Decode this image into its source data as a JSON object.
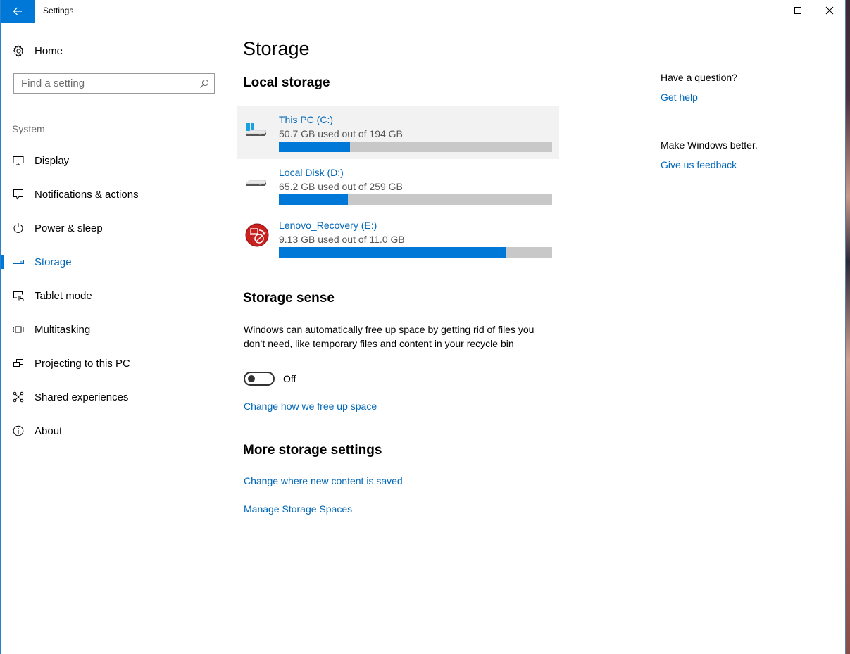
{
  "window": {
    "title": "Settings",
    "controls": {
      "minimize": "minimize-icon",
      "maximize": "maximize-icon",
      "close": "close-icon"
    }
  },
  "sidebar": {
    "home_label": "Home",
    "search_placeholder": "Find a setting",
    "group_label": "System",
    "items": [
      {
        "label": "Display",
        "icon": "display-icon",
        "active": false
      },
      {
        "label": "Notifications & actions",
        "icon": "notifications-icon",
        "active": false
      },
      {
        "label": "Power & sleep",
        "icon": "power-icon",
        "active": false
      },
      {
        "label": "Storage",
        "icon": "storage-icon",
        "active": true
      },
      {
        "label": "Tablet mode",
        "icon": "tablet-mode-icon",
        "active": false
      },
      {
        "label": "Multitasking",
        "icon": "multitasking-icon",
        "active": false
      },
      {
        "label": "Projecting to this PC",
        "icon": "projecting-icon",
        "active": false
      },
      {
        "label": "Shared experiences",
        "icon": "shared-experiences-icon",
        "active": false
      },
      {
        "label": "About",
        "icon": "info-icon",
        "active": false
      }
    ]
  },
  "main": {
    "page_title": "Storage",
    "local_storage_title": "Local storage",
    "drives": [
      {
        "name": "This PC (C:)",
        "usage": "50.7 GB used out of 194 GB",
        "used_fraction": 0.261,
        "icon": "system-drive-icon",
        "selected": true
      },
      {
        "name": "Local Disk (D:)",
        "usage": "65.2 GB used out of 259 GB",
        "used_fraction": 0.252,
        "icon": "hard-drive-icon",
        "selected": false
      },
      {
        "name": "Lenovo_Recovery (E:)",
        "usage": "9.13 GB used out of 11.0 GB",
        "used_fraction": 0.83,
        "icon": "recovery-drive-icon",
        "selected": false
      }
    ],
    "storage_sense": {
      "title": "Storage sense",
      "description": "Windows can automatically free up space by getting rid of files you don’t need, like temporary files and content in your recycle bin",
      "toggle_state": "Off",
      "link": "Change how we free up space"
    },
    "more_settings": {
      "title": "More storage settings",
      "links": [
        "Change where new content is saved",
        "Manage Storage Spaces"
      ]
    }
  },
  "aside": {
    "question": "Have a question?",
    "help_link": "Get help",
    "better": "Make Windows better.",
    "feedback_link": "Give us feedback"
  },
  "colors": {
    "accent": "#0078d7",
    "link": "#0067b8",
    "bar_track": "#c8c8c8"
  }
}
